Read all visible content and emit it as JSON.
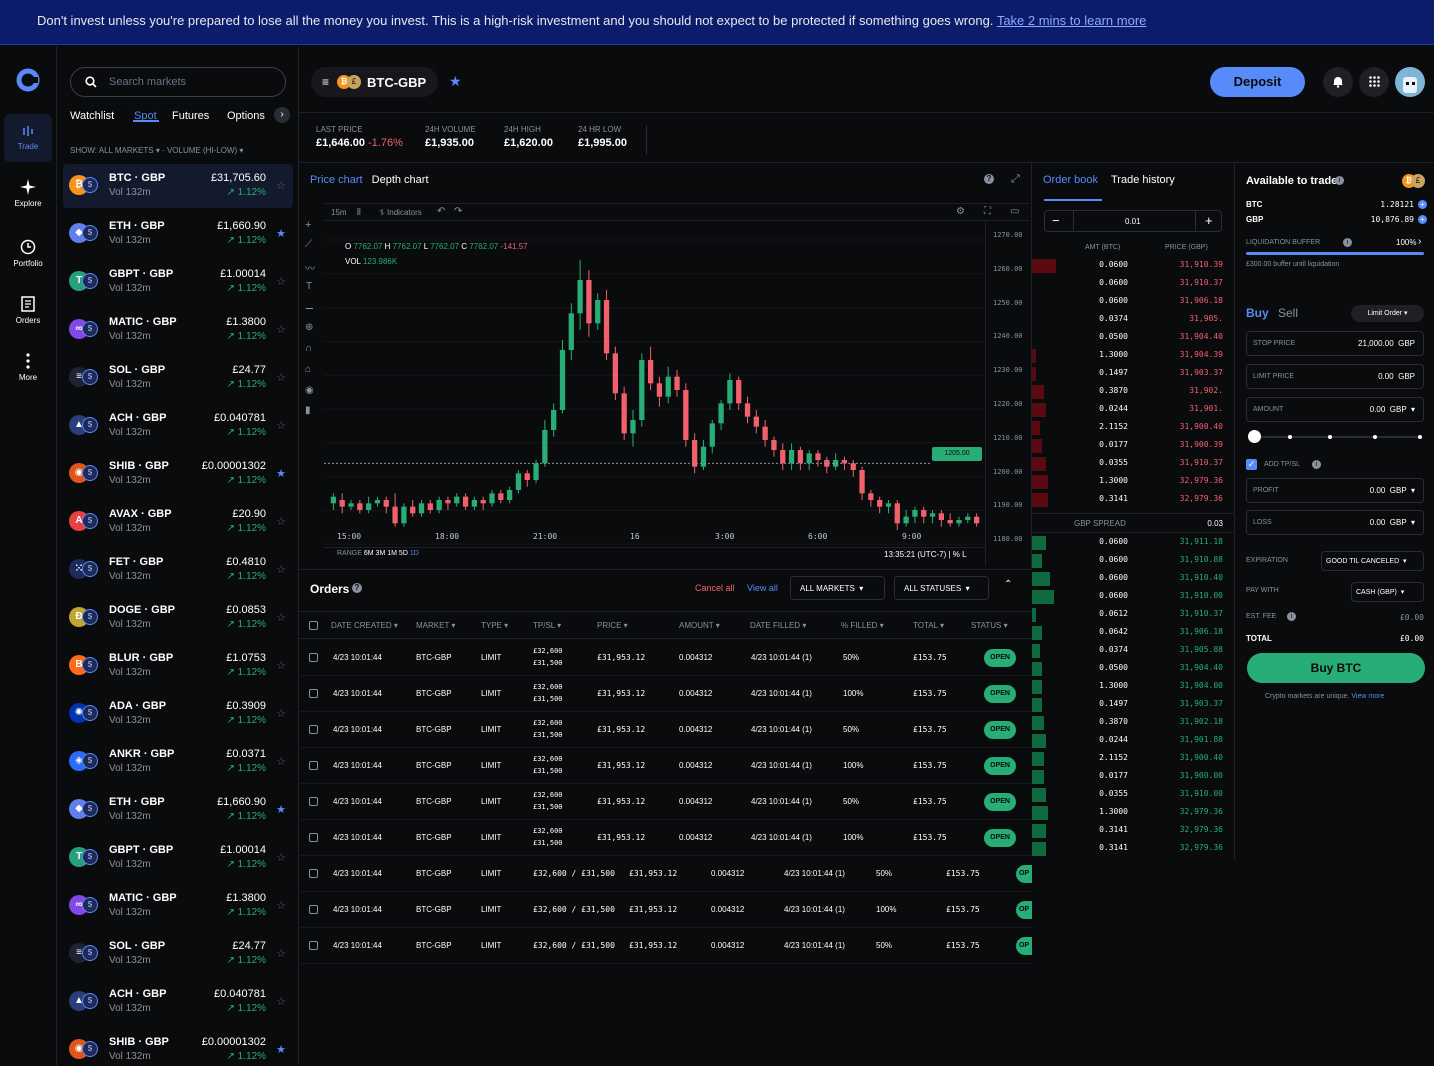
{
  "banner": {
    "text": "Don't invest unless you're prepared to lose all the money you invest. This is a high-risk investment and you should not expect to be protected if something goes wrong.",
    "link": "Take 2 mins to learn more"
  },
  "nav": [
    {
      "label": "Trade",
      "icon": "trade-icon"
    },
    {
      "label": "Explore",
      "icon": "sparkle-icon"
    },
    {
      "label": "Portfolio",
      "icon": "clock-icon"
    },
    {
      "label": "Orders",
      "icon": "document-icon"
    },
    {
      "label": "More",
      "icon": "more-icon"
    }
  ],
  "markets": {
    "search_placeholder": "Search markets",
    "tabs": [
      "Watchlist",
      "Spot",
      "Futures",
      "Options"
    ],
    "show_label": "SHOW:",
    "show_value": "ALL MARKETS",
    "sort_value": "VOLUME (HI-LOW)",
    "rows": [
      {
        "pair": "BTC · GBP",
        "vol": "Vol 132m",
        "price": "£31,705.60",
        "change": "↗ 1.12%",
        "starred": false,
        "glyph": "₿",
        "color": "#f7931a"
      },
      {
        "pair": "ETH · GBP",
        "vol": "Vol 132m",
        "price": "£1,660.90",
        "change": "↗ 1.12%",
        "starred": true,
        "glyph": "◆",
        "color": "#627eea"
      },
      {
        "pair": "GBPT · GBP",
        "vol": "Vol 132m",
        "price": "£1.00014",
        "change": "↗ 1.12%",
        "starred": false,
        "glyph": "T",
        "color": "#26a17b"
      },
      {
        "pair": "MATIC · GBP",
        "vol": "Vol 132m",
        "price": "£1.3800",
        "change": "↗ 1.12%",
        "starred": false,
        "glyph": "∞",
        "color": "#8247e5"
      },
      {
        "pair": "SOL · GBP",
        "vol": "Vol 132m",
        "price": "£24.77",
        "change": "↗ 1.12%",
        "starred": false,
        "glyph": "≡",
        "color": "#1e2235"
      },
      {
        "pair": "ACH · GBP",
        "vol": "Vol 132m",
        "price": "£0.040781",
        "change": "↗ 1.12%",
        "starred": false,
        "glyph": "▲",
        "color": "#2c3e7a"
      },
      {
        "pair": "SHIB · GBP",
        "vol": "Vol 132m",
        "price": "£0.00001302",
        "change": "↗ 1.12%",
        "starred": true,
        "glyph": "◉",
        "color": "#e0551b"
      },
      {
        "pair": "AVAX · GBP",
        "vol": "Vol 132m",
        "price": "£20.90",
        "change": "↗ 1.12%",
        "starred": false,
        "glyph": "A",
        "color": "#e84142"
      },
      {
        "pair": "FET · GBP",
        "vol": "Vol 132m",
        "price": "£0.4810",
        "change": "↗ 1.12%",
        "starred": false,
        "glyph": "⁙",
        "color": "#1d2a5c"
      },
      {
        "pair": "DOGE · GBP",
        "vol": "Vol 132m",
        "price": "£0.0853",
        "change": "↗ 1.12%",
        "starred": false,
        "glyph": "Ð",
        "color": "#c2a633"
      },
      {
        "pair": "BLUR · GBP",
        "vol": "Vol 132m",
        "price": "£1.0753",
        "change": "↗ 1.12%",
        "starred": false,
        "glyph": "B",
        "color": "#ff6b1a"
      },
      {
        "pair": "ADA · GBP",
        "vol": "Vol 132m",
        "price": "£0.3909",
        "change": "↗ 1.12%",
        "starred": false,
        "glyph": "✺",
        "color": "#0033ad"
      },
      {
        "pair": "ANKR · GBP",
        "vol": "Vol 132m",
        "price": "£0.0371",
        "change": "↗ 1.12%",
        "starred": false,
        "glyph": "◈",
        "color": "#2e6bf6"
      },
      {
        "pair": "ETH · GBP",
        "vol": "Vol 132m",
        "price": "£1,660.90",
        "change": "↗ 1.12%",
        "starred": true,
        "glyph": "◆",
        "color": "#627eea"
      },
      {
        "pair": "GBPT · GBP",
        "vol": "Vol 132m",
        "price": "£1.00014",
        "change": "↗ 1.12%",
        "starred": false,
        "glyph": "T",
        "color": "#26a17b"
      },
      {
        "pair": "MATIC · GBP",
        "vol": "Vol 132m",
        "price": "£1.3800",
        "change": "↗ 1.12%",
        "starred": false,
        "glyph": "∞",
        "color": "#8247e5"
      },
      {
        "pair": "SOL · GBP",
        "vol": "Vol 132m",
        "price": "£24.77",
        "change": "↗ 1.12%",
        "starred": false,
        "glyph": "≡",
        "color": "#1e2235"
      },
      {
        "pair": "ACH · GBP",
        "vol": "Vol 132m",
        "price": "£0.040781",
        "change": "↗ 1.12%",
        "starred": false,
        "glyph": "▲",
        "color": "#2c3e7a"
      },
      {
        "pair": "SHIB · GBP",
        "vol": "Vol 132m",
        "price": "£0.00001302",
        "change": "↗ 1.12%",
        "starred": true,
        "glyph": "◉",
        "color": "#e0551b"
      }
    ]
  },
  "header": {
    "pair": "BTC-GBP",
    "deposit": "Deposit"
  },
  "stats": [
    {
      "label": "LAST PRICE",
      "value": "£1,646.00",
      "change": "-1.76%"
    },
    {
      "label": "24H VOLUME",
      "value": "£1,935.00"
    },
    {
      "label": "24H HIGH",
      "value": "£1,620.00"
    },
    {
      "label": "24 HR LOW",
      "value": "£1,995.00"
    }
  ],
  "chart": {
    "tabs": [
      "Price chart",
      "Depth chart"
    ],
    "interval": "15m",
    "indicators": "Indicators",
    "ohlc": {
      "o": "7762.07",
      "h": "7762.07",
      "l": "7762.07",
      "c": "7762.07",
      "chg": "-141.57"
    },
    "vol": "123.986K",
    "last_label": "1205.00",
    "y_ticks": [
      "1270.00",
      "1260.00",
      "1250.00",
      "1240.00",
      "1230.00",
      "1220.00",
      "1210.00",
      "1200.00",
      "1190.00",
      "1180.00"
    ],
    "x_ticks": [
      "15:00",
      "18:00",
      "21:00",
      "16",
      "3:00",
      "6:00",
      "9:00"
    ],
    "range_label": "RANGE",
    "ranges": [
      "6M",
      "3M",
      "1M",
      "5D",
      "1D"
    ],
    "clock": "13:35:21 (UTC-7)",
    "pct": "% L"
  },
  "chart_data": {
    "type": "candlestick",
    "ylim": [
      1185,
      1275
    ],
    "x_ticks": [
      "15:00",
      "18:00",
      "21:00",
      "16",
      "3:00",
      "6:00",
      "9:00"
    ],
    "last_price": 1205,
    "candles": [
      [
        1193,
        1195,
        1191,
        1196
      ],
      [
        1194,
        1192,
        1190,
        1196
      ],
      [
        1192,
        1193,
        1191,
        1194
      ],
      [
        1193,
        1191,
        1190,
        1194
      ],
      [
        1191,
        1193,
        1190,
        1195
      ],
      [
        1193,
        1194,
        1192,
        1195
      ],
      [
        1194,
        1192,
        1190,
        1195
      ],
      [
        1192,
        1187,
        1186,
        1196
      ],
      [
        1187,
        1192,
        1186,
        1193
      ],
      [
        1192,
        1190,
        1189,
        1194
      ],
      [
        1190,
        1193,
        1189,
        1194
      ],
      [
        1193,
        1191,
        1190,
        1194
      ],
      [
        1191,
        1194,
        1190,
        1195
      ],
      [
        1194,
        1193,
        1191,
        1195
      ],
      [
        1193,
        1195,
        1192,
        1196
      ],
      [
        1195,
        1192,
        1191,
        1196
      ],
      [
        1192,
        1194,
        1191,
        1195
      ],
      [
        1194,
        1193,
        1191,
        1195
      ],
      [
        1193,
        1196,
        1192,
        1197
      ],
      [
        1196,
        1194,
        1193,
        1197
      ],
      [
        1194,
        1197,
        1193,
        1198
      ],
      [
        1197,
        1202,
        1196,
        1203
      ],
      [
        1202,
        1200,
        1198,
        1203
      ],
      [
        1200,
        1205,
        1199,
        1206
      ],
      [
        1205,
        1215,
        1204,
        1218
      ],
      [
        1215,
        1221,
        1213,
        1223
      ],
      [
        1221,
        1239,
        1220,
        1242
      ],
      [
        1239,
        1250,
        1236,
        1253
      ],
      [
        1250,
        1260,
        1245,
        1266
      ],
      [
        1260,
        1247,
        1243,
        1263
      ],
      [
        1247,
        1254,
        1245,
        1256
      ],
      [
        1254,
        1238,
        1236,
        1257
      ],
      [
        1238,
        1226,
        1224,
        1240
      ],
      [
        1226,
        1214,
        1212,
        1228
      ],
      [
        1214,
        1218,
        1210,
        1221
      ],
      [
        1218,
        1236,
        1216,
        1238
      ],
      [
        1236,
        1229,
        1227,
        1240
      ],
      [
        1229,
        1225,
        1222,
        1231
      ],
      [
        1225,
        1231,
        1223,
        1234
      ],
      [
        1231,
        1227,
        1225,
        1233
      ],
      [
        1227,
        1212,
        1210,
        1229
      ],
      [
        1212,
        1204,
        1202,
        1214
      ],
      [
        1204,
        1210,
        1203,
        1212
      ],
      [
        1210,
        1217,
        1208,
        1218
      ],
      [
        1217,
        1223,
        1215,
        1224
      ],
      [
        1223,
        1230,
        1221,
        1232
      ],
      [
        1230,
        1223,
        1221,
        1231
      ],
      [
        1223,
        1219,
        1217,
        1225
      ],
      [
        1219,
        1216,
        1214,
        1221
      ],
      [
        1216,
        1212,
        1210,
        1218
      ],
      [
        1212,
        1209,
        1207,
        1213
      ],
      [
        1209,
        1205,
        1203,
        1211
      ],
      [
        1205,
        1209,
        1203,
        1211
      ],
      [
        1209,
        1205,
        1203,
        1210
      ],
      [
        1205,
        1208,
        1203,
        1209
      ],
      [
        1208,
        1206,
        1204,
        1209
      ],
      [
        1206,
        1204,
        1202,
        1207
      ],
      [
        1204,
        1206,
        1203,
        1208
      ],
      [
        1206,
        1205,
        1203,
        1207
      ],
      [
        1205,
        1203,
        1201,
        1206
      ],
      [
        1203,
        1196,
        1194,
        1204
      ],
      [
        1196,
        1194,
        1192,
        1197
      ],
      [
        1194,
        1192,
        1190,
        1195
      ],
      [
        1192,
        1193,
        1190,
        1194
      ],
      [
        1193,
        1187,
        1185,
        1194
      ],
      [
        1187,
        1189,
        1186,
        1191
      ],
      [
        1189,
        1191,
        1187,
        1192
      ],
      [
        1191,
        1189,
        1187,
        1192
      ],
      [
        1189,
        1190,
        1187,
        1191
      ],
      [
        1190,
        1188,
        1186,
        1191
      ],
      [
        1188,
        1187,
        1186,
        1190
      ],
      [
        1187,
        1188,
        1186,
        1189
      ],
      [
        1188,
        1189,
        1187,
        1190
      ],
      [
        1189,
        1187,
        1186,
        1190
      ]
    ]
  },
  "orders": {
    "title": "Orders",
    "cancel_all": "Cancel all",
    "view_all": "View all",
    "filter_markets": "ALL MARKETS",
    "filter_statuses": "ALL STATUSES",
    "columns": [
      "DATE CREATED",
      "MARKET",
      "TYPE",
      "TP/SL",
      "PRICE",
      "AMOUNT",
      "DATE FILLED",
      "% FILLED",
      "TOTAL",
      "STATUS"
    ],
    "rows": [
      {
        "date": "4/23 10:01:44",
        "market": "BTC-GBP",
        "type": "LIMIT",
        "tp": "£32,600",
        "sl": "£31,500",
        "price": "£31,953.12",
        "amount": "0.004312",
        "filled_date": "4/23 10:01:44 (1)",
        "pct": "50%",
        "total": "£153.75",
        "status": "OPEN"
      },
      {
        "date": "4/23 10:01:44",
        "market": "BTC-GBP",
        "type": "LIMIT",
        "tp": "£32,600",
        "sl": "£31,500",
        "price": "£31,953.12",
        "amount": "0.004312",
        "filled_date": "4/23 10:01:44 (1)",
        "pct": "100%",
        "total": "£153.75",
        "status": "OPEN"
      },
      {
        "date": "4/23 10:01:44",
        "market": "BTC-GBP",
        "type": "LIMIT",
        "tp": "£32,600",
        "sl": "£31,500",
        "price": "£31,953.12",
        "amount": "0.004312",
        "filled_date": "4/23 10:01:44 (1)",
        "pct": "50%",
        "total": "£153.75",
        "status": "OPEN"
      },
      {
        "date": "4/23 10:01:44",
        "market": "BTC-GBP",
        "type": "LIMIT",
        "tp": "£32,600",
        "sl": "£31,500",
        "price": "£31,953.12",
        "amount": "0.004312",
        "filled_date": "4/23 10:01:44 (1)",
        "pct": "100%",
        "total": "£153.75",
        "status": "OPEN"
      },
      {
        "date": "4/23 10:01:44",
        "market": "BTC-GBP",
        "type": "LIMIT",
        "tp": "£32,600",
        "sl": "£31,500",
        "price": "£31,953.12",
        "amount": "0.004312",
        "filled_date": "4/23 10:01:44 (1)",
        "pct": "50%",
        "total": "£153.75",
        "status": "OPEN"
      },
      {
        "date": "4/23 10:01:44",
        "market": "BTC-GBP",
        "type": "LIMIT",
        "tp": "£32,600",
        "sl": "£31,500",
        "price": "£31,953.12",
        "amount": "0.004312",
        "filled_date": "4/23 10:01:44 (1)",
        "pct": "100%",
        "total": "£153.75",
        "status": "OPEN"
      }
    ],
    "rows_wide": [
      {
        "date": "4/23 10:01:44",
        "market": "BTC-GBP",
        "type": "LIMIT",
        "tpsl": "£32,600 / £31,500",
        "price": "£31,953.12",
        "amount": "0.004312",
        "filled_date": "4/23 10:01:44 (1)",
        "pct": "50%",
        "total": "£153.75",
        "status": "OP"
      },
      {
        "date": "4/23 10:01:44",
        "market": "BTC-GBP",
        "type": "LIMIT",
        "tpsl": "£32,600 / £31,500",
        "price": "£31,953.12",
        "amount": "0.004312",
        "filled_date": "4/23 10:01:44 (1)",
        "pct": "100%",
        "total": "£153.75",
        "status": "OP"
      },
      {
        "date": "4/23 10:01:44",
        "market": "BTC-GBP",
        "type": "LIMIT",
        "tpsl": "£32,600 / £31,500",
        "price": "£31,953.12",
        "amount": "0.004312",
        "filled_date": "4/23 10:01:44 (1)",
        "pct": "50%",
        "total": "£153.75",
        "status": "OP"
      }
    ]
  },
  "orderbook": {
    "tabs": [
      "Order book",
      "Trade history"
    ],
    "step": "0.01",
    "col_amt": "AMT (BTC)",
    "col_price": "PRICE (GBP)",
    "spread_label": "GBP SPREAD",
    "spread_value": "0.03",
    "asks": [
      {
        "amt": "0.0600",
        "price": "31,910.39",
        "depth": 0.12
      },
      {
        "amt": "0.0600",
        "price": "31,910.37",
        "depth": 0.0
      },
      {
        "amt": "0.0600",
        "price": "31,906.18",
        "depth": 0.0
      },
      {
        "amt": "0.0374",
        "price": "31,905.",
        "depth": 0.0
      },
      {
        "amt": "0.0500",
        "price": "31,904.40",
        "depth": 0.0
      },
      {
        "amt": "1.3000",
        "price": "31,904.39",
        "depth": 0.02
      },
      {
        "amt": "0.1497",
        "price": "31,903.37",
        "depth": 0.02
      },
      {
        "amt": "0.3870",
        "price": "31,902.",
        "depth": 0.06
      },
      {
        "amt": "0.0244",
        "price": "31,901.",
        "depth": 0.07
      },
      {
        "amt": "2.1152",
        "price": "31,900.40",
        "depth": 0.04
      },
      {
        "amt": "0.0177",
        "price": "31,900.39",
        "depth": 0.05
      },
      {
        "amt": "0.0355",
        "price": "31,910.37",
        "depth": 0.07
      },
      {
        "amt": "1.3000",
        "price": "32,979.36",
        "depth": 0.08
      },
      {
        "amt": "0.3141",
        "price": "32,979.36",
        "depth": 0.08
      }
    ],
    "bids": [
      {
        "amt": "0.0600",
        "price": "31,911.18",
        "depth": 0.07
      },
      {
        "amt": "0.0600",
        "price": "31,910.88",
        "depth": 0.05
      },
      {
        "amt": "0.0600",
        "price": "31,910.40",
        "depth": 0.09
      },
      {
        "amt": "0.0600",
        "price": "31,910.00",
        "depth": 0.11
      },
      {
        "amt": "0.0612",
        "price": "31,910.37",
        "depth": 0.02
      },
      {
        "amt": "0.0642",
        "price": "31,906.18",
        "depth": 0.05
      },
      {
        "amt": "0.0374",
        "price": "31,905.88",
        "depth": 0.04
      },
      {
        "amt": "0.0500",
        "price": "31,904.40",
        "depth": 0.05
      },
      {
        "amt": "1.3000",
        "price": "31,904.00",
        "depth": 0.05
      },
      {
        "amt": "0.1497",
        "price": "31,903.37",
        "depth": 0.05
      },
      {
        "amt": "0.3870",
        "price": "31,902.18",
        "depth": 0.06
      },
      {
        "amt": "0.0244",
        "price": "31,901.88",
        "depth": 0.07
      },
      {
        "amt": "2.1152",
        "price": "31,900.40",
        "depth": 0.06
      },
      {
        "amt": "0.0177",
        "price": "31,900.00",
        "depth": 0.06
      },
      {
        "amt": "0.0355",
        "price": "31,910.00",
        "depth": 0.07
      },
      {
        "amt": "1.3000",
        "price": "32,979.36",
        "depth": 0.08
      },
      {
        "amt": "0.3141",
        "price": "32,979.36",
        "depth": 0.07
      },
      {
        "amt": "0.3141",
        "price": "32,979.36",
        "depth": 0.07
      }
    ]
  },
  "trade": {
    "available": "Available to trade",
    "btc_label": "BTC",
    "btc_value": "1.28121",
    "gbp_label": "GBP",
    "gbp_value": "10,876.89",
    "liq_label": "LIQUIDATION BUFFER",
    "liq_value": "100%",
    "liq_note": "£300.00 buffer until liquidation",
    "buy": "Buy",
    "sell": "Sell",
    "order_type": "Limit Order",
    "stop_label": "STOP PRICE",
    "stop_value": "21,000.00",
    "stop_cur": "GBP",
    "limit_label": "LIMIT PRICE",
    "limit_value": "0.00",
    "limit_cur": "GBP",
    "amount_label": "AMOUNT",
    "amount_value": "0.00",
    "amount_cur": "GBP",
    "slider_level": 0,
    "tpsl_label": "ADD TP/SL",
    "profit_label": "PROFIT",
    "profit_value": "0.00",
    "profit_cur": "GBP",
    "loss_label": "LOSS",
    "loss_value": "0.00",
    "loss_cur": "GBP",
    "exp_label": "EXPIRATION",
    "exp_value": "GOOD TIL CANCELED",
    "pay_label": "PAY WITH",
    "pay_value": "CASH (GBP)",
    "fee_label": "EST. FEE",
    "fee_value": "£0.00",
    "total_label": "TOTAL",
    "total_value": "£0.00",
    "buy_button": "Buy BTC",
    "note": "Crypto markets are unique.",
    "note_link": "View more"
  },
  "colors": {
    "accent": "#578bfa",
    "up": "#27ad75",
    "down": "#f0616d",
    "banner": "#0d1b6b"
  }
}
